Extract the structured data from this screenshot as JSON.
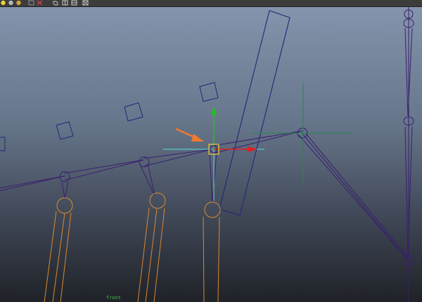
{
  "toolbar": {
    "icons": [
      "yellow-sphere-icon",
      "gray-sphere-icon",
      "shaded-sphere-icon",
      "dashed-select-icon",
      "cube-icon",
      "panel-icon",
      "cross-box-icon"
    ]
  },
  "viewport": {
    "camera_label": "front",
    "colors": {
      "background_top": "#8494ac",
      "background_bottom": "#1f2227",
      "joint_chain": "#3a1f6e",
      "ik_handle": "#1d2a7a",
      "geometry": "#d88a30",
      "manipulator_x": "#e02020",
      "manipulator_y": "#20c020",
      "manipulator_cyan": "#50e0e0",
      "annotation_arrow": "#f07a30"
    }
  }
}
